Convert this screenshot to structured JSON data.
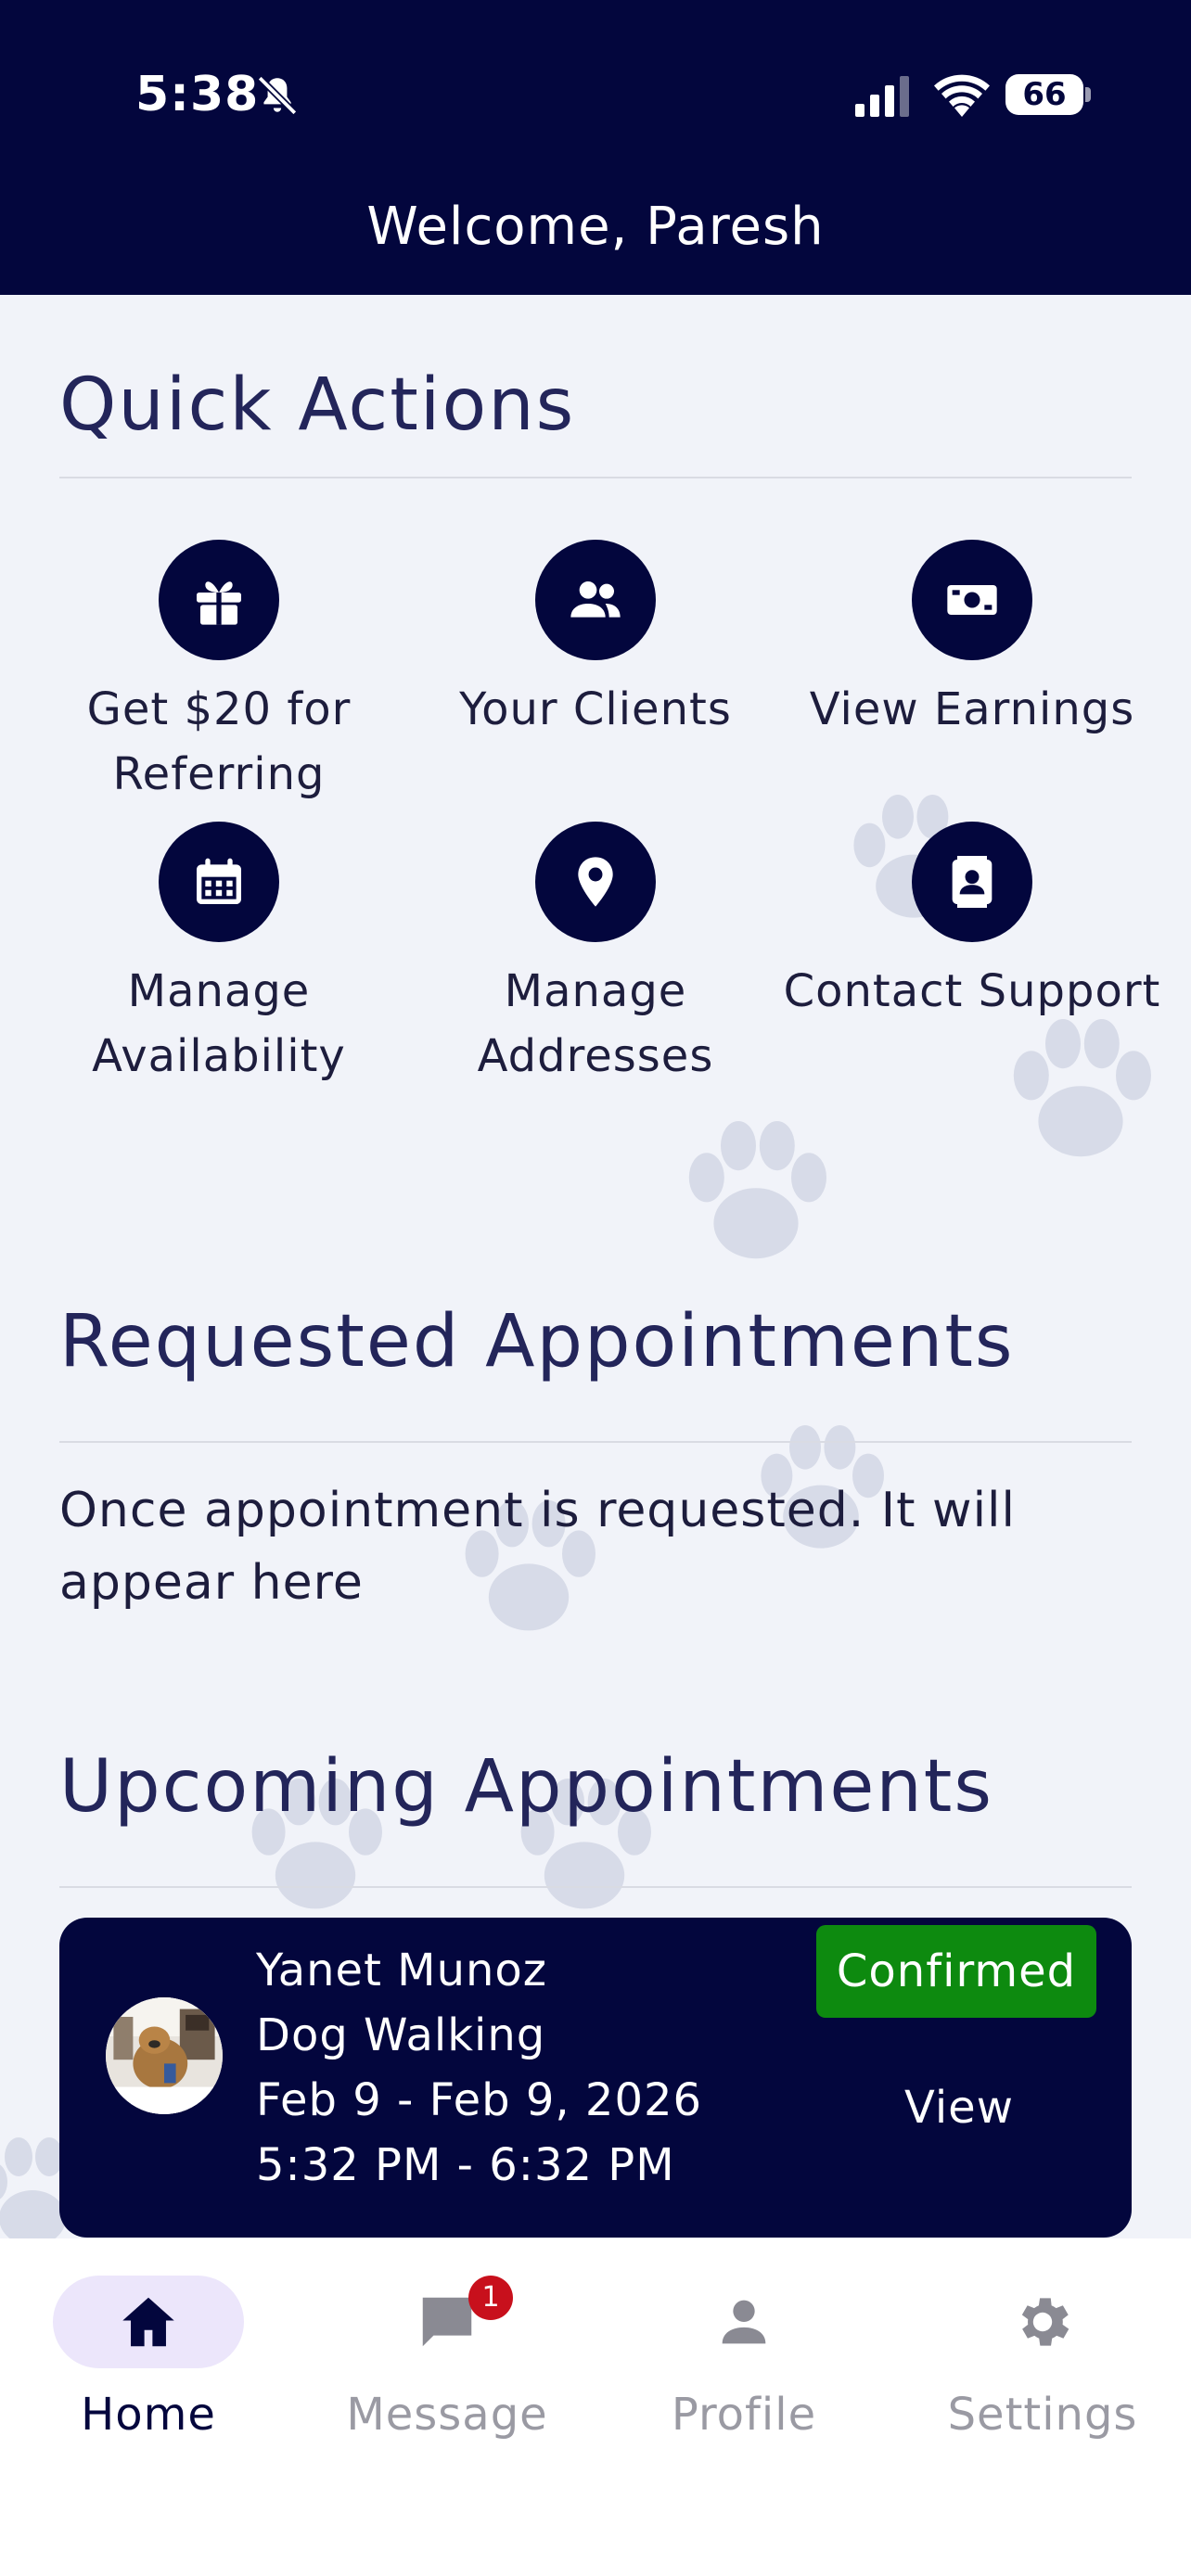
{
  "status_bar": {
    "time": "5:38",
    "battery": "66"
  },
  "header": {
    "welcome": "Welcome, Paresh"
  },
  "quick_actions": {
    "title": "Quick Actions",
    "items": [
      {
        "label": "Get $20 for Referring",
        "icon": "gift-icon"
      },
      {
        "label": "Your Clients",
        "icon": "people-icon"
      },
      {
        "label": "View Earnings",
        "icon": "money-icon"
      },
      {
        "label": "Manage Availability",
        "icon": "calendar-icon"
      },
      {
        "label": "Manage Addresses",
        "icon": "location-pin-icon"
      },
      {
        "label": "Contact Support",
        "icon": "contact-card-icon"
      }
    ]
  },
  "requested": {
    "title": "Requested Appointments",
    "empty_text": "Once appointment is requested. It will appear here"
  },
  "upcoming": {
    "title": "Upcoming Appointments",
    "appointment": {
      "client": "Yanet Munoz",
      "service": "Dog Walking",
      "dates": "Feb 9 - Feb 9, 2026",
      "time": "5:32 PM - 6:32 PM",
      "status": "Confirmed",
      "action": "View"
    }
  },
  "tabbar": {
    "tabs": [
      {
        "label": "Home",
        "icon": "home-icon",
        "active": true
      },
      {
        "label": "Message",
        "icon": "message-icon",
        "badge": "1"
      },
      {
        "label": "Profile",
        "icon": "profile-icon"
      },
      {
        "label": "Settings",
        "icon": "gear-icon"
      }
    ]
  },
  "colors": {
    "header": "#03063d",
    "background": "#f1f3f9",
    "confirmed": "#0d8a0f",
    "active_pill": "#ece6fb",
    "badge": "#c8101c"
  }
}
